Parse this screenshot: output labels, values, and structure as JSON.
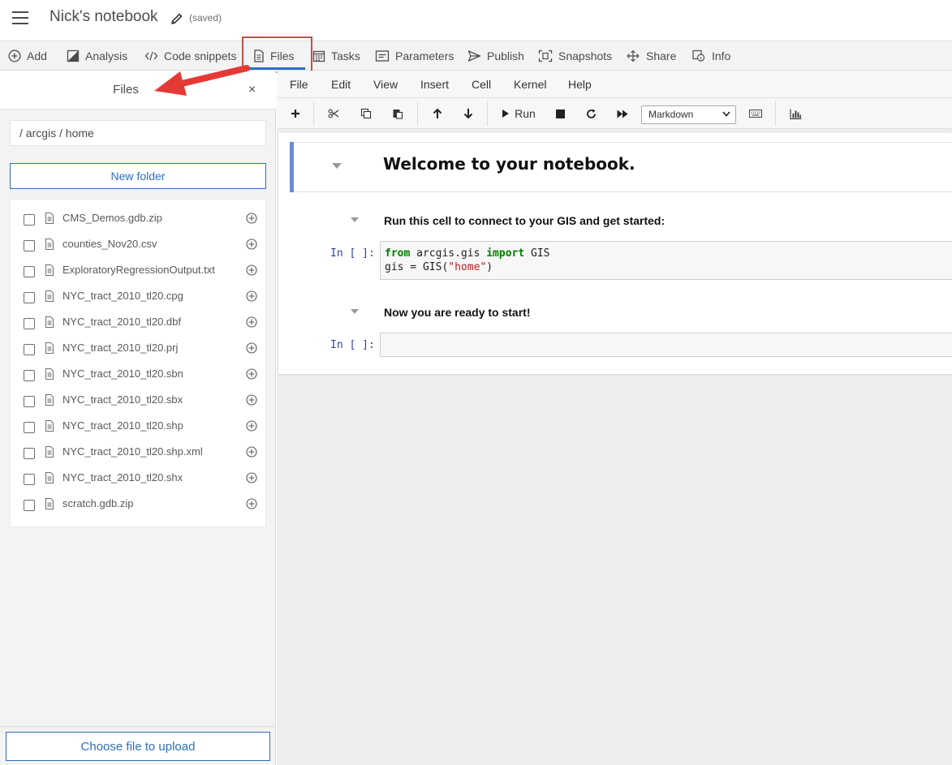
{
  "header": {
    "title": "Nick's notebook",
    "saved_label": "(saved)"
  },
  "tabs": [
    {
      "label": "Add",
      "icon": "plus-circle-icon"
    },
    {
      "label": "Analysis",
      "icon": "analysis-icon"
    },
    {
      "label": "Code snippets",
      "icon": "code-icon"
    },
    {
      "label": "Files",
      "icon": "file-icon"
    },
    {
      "label": "Tasks",
      "icon": "calendar-icon"
    },
    {
      "label": "Parameters",
      "icon": "parameters-icon"
    },
    {
      "label": "Publish",
      "icon": "send-icon"
    },
    {
      "label": "Snapshots",
      "icon": "snapshot-icon"
    },
    {
      "label": "Share",
      "icon": "share-icon"
    },
    {
      "label": "Info",
      "icon": "info-icon"
    }
  ],
  "active_tab": "Files",
  "files_panel": {
    "title": "Files",
    "close_label": "×",
    "breadcrumb": "/ arcgis / home",
    "new_folder_label": "New folder",
    "upload_label": "Choose file to upload",
    "files": [
      "CMS_Demos.gdb.zip",
      "counties_Nov20.csv",
      "ExploratoryRegressionOutput.txt",
      "NYC_tract_2010_tl20.cpg",
      "NYC_tract_2010_tl20.dbf",
      "NYC_tract_2010_tl20.prj",
      "NYC_tract_2010_tl20.sbn",
      "NYC_tract_2010_tl20.sbx",
      "NYC_tract_2010_tl20.shp",
      "NYC_tract_2010_tl20.shp.xml",
      "NYC_tract_2010_tl20.shx",
      "scratch.gdb.zip"
    ]
  },
  "menu": [
    "File",
    "Edit",
    "View",
    "Insert",
    "Cell",
    "Kernel",
    "Help"
  ],
  "toolbar": {
    "run_label": "Run",
    "cell_type": "Markdown"
  },
  "cells": {
    "heading1": "Welcome to your notebook.",
    "heading2": "Run this cell to connect to your GIS and get started:",
    "prompt1": "In [ ]:",
    "code_line1": {
      "kw1": "from",
      "mod": " arcgis.gis ",
      "kw2": "import",
      "rest": " GIS"
    },
    "code_line2": {
      "pre": "gis = GIS(",
      "str": "\"home\"",
      "post": ")"
    },
    "heading3": "Now you are ready to start!",
    "prompt2": "In [ ]:"
  },
  "colors": {
    "accent": "#2e6fbf",
    "highlight_box": "#c0504d",
    "annotation_arrow": "#e53935",
    "selected_cell_bar": "#6a8bd6"
  }
}
